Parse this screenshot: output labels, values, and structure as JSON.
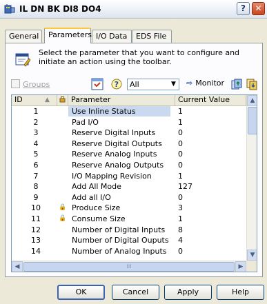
{
  "window": {
    "title": "IL DN BK DI8 DO4",
    "help_label": "?",
    "close_label": "✕"
  },
  "tabs": [
    "General",
    "Parameters",
    "I/O Data",
    "EDS File"
  ],
  "active_tab": "Parameters",
  "instructions": "Select the parameter that you want to configure and initiate an action using the toolbar.",
  "toolbar": {
    "groups_label": "Groups",
    "groups_checked": false,
    "filter_value": "All",
    "monitor_label": "Monitor"
  },
  "grid": {
    "headers": {
      "id": "ID",
      "lock": "",
      "name": "Parameter",
      "value": "Current Value"
    },
    "rows": [
      {
        "id": "1",
        "locked": false,
        "name": "Use Inline Status",
        "value": "1"
      },
      {
        "id": "2",
        "locked": false,
        "name": "Pad I/O",
        "value": "1"
      },
      {
        "id": "3",
        "locked": false,
        "name": "Reserve Digital Inputs",
        "value": "0"
      },
      {
        "id": "4",
        "locked": false,
        "name": "Reserve Digital Outputs",
        "value": "0"
      },
      {
        "id": "5",
        "locked": false,
        "name": "Reserve Analog Inputs",
        "value": "0"
      },
      {
        "id": "6",
        "locked": false,
        "name": "Reserve Analog Outputs",
        "value": "0"
      },
      {
        "id": "7",
        "locked": false,
        "name": "I/O Mapping Revision",
        "value": "1"
      },
      {
        "id": "8",
        "locked": false,
        "name": "Add All Mode",
        "value": "127"
      },
      {
        "id": "9",
        "locked": false,
        "name": "Add all I/O",
        "value": "0"
      },
      {
        "id": "10",
        "locked": true,
        "name": "Produce Size",
        "value": "3"
      },
      {
        "id": "11",
        "locked": true,
        "name": "Consume Size",
        "value": "1"
      },
      {
        "id": "12",
        "locked": false,
        "name": "Number of Digital Inputs",
        "value": "8"
      },
      {
        "id": "13",
        "locked": false,
        "name": "Number of Digital Ouputs",
        "value": "4"
      },
      {
        "id": "14",
        "locked": false,
        "name": "Number of Analog Inputs",
        "value": "0"
      }
    ]
  },
  "buttons": {
    "ok": "OK",
    "cancel": "Cancel",
    "apply": "Apply",
    "help": "Help"
  }
}
